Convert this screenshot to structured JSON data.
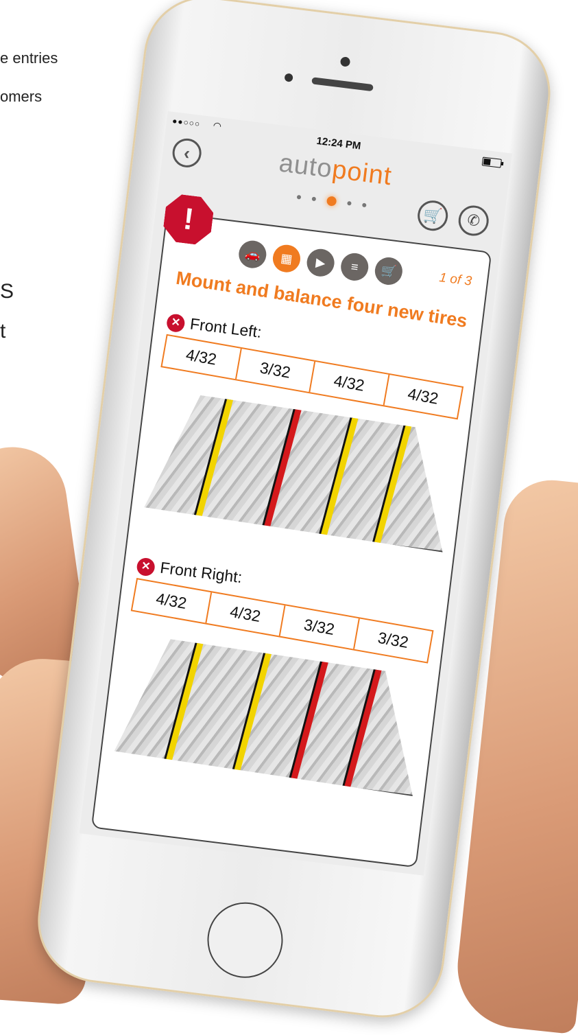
{
  "background_text": {
    "line1": "e entries",
    "line2": "omers",
    "glyph1": "S",
    "glyph2": "t"
  },
  "status_bar": {
    "carrier": "●●○○○",
    "wifi_icon": "wifi-icon",
    "time": "12:24 PM",
    "battery_icon": "battery-icon"
  },
  "header": {
    "back_icon": "‹",
    "logo_auto": "auto",
    "logo_point": "point",
    "page_dots": 5,
    "active_dot": 3,
    "cart_icon": "🛒",
    "phone_icon": "✆"
  },
  "card": {
    "alert_icon": "!",
    "step_icons": [
      {
        "name": "car-icon",
        "glyph": "🚗"
      },
      {
        "name": "tread-gauge-icon",
        "glyph": "▦"
      },
      {
        "name": "play-icon",
        "glyph": "▶"
      },
      {
        "name": "document-icon",
        "glyph": "≡"
      },
      {
        "name": "cart-icon",
        "glyph": "🛒"
      }
    ],
    "active_step": 2,
    "page_count": "1 of 3",
    "title": "Mount and balance four new tires",
    "tires": {
      "front_left": {
        "label": "Front Left:",
        "readings": [
          "4/32",
          "3/32",
          "4/32",
          "4/32"
        ],
        "grooves": [
          "yellow",
          "red",
          "yellow",
          "yellow"
        ]
      },
      "front_right": {
        "label": "Front Right:",
        "readings": [
          "4/32",
          "4/32",
          "3/32",
          "3/32"
        ],
        "grooves": [
          "yellow",
          "yellow",
          "red",
          "red"
        ]
      }
    }
  },
  "colors": {
    "accent": "#f07b20",
    "alert": "#c8102e",
    "icon_gray": "#6b6663"
  }
}
